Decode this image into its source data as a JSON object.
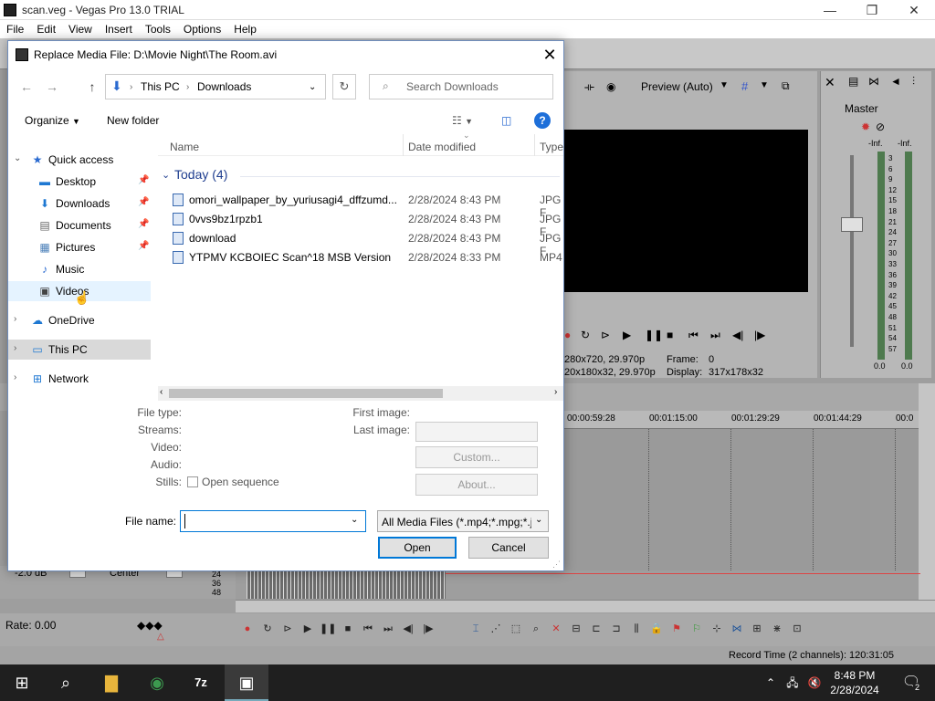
{
  "vegas": {
    "title": "scan.veg - Vegas Pro 13.0 TRIAL",
    "menu": [
      "File",
      "Edit",
      "View",
      "Insert",
      "Tools",
      "Options",
      "Help"
    ],
    "preview_label": "Preview (Auto)",
    "preview_info_1": "280x720, 29.970p",
    "preview_info_2": "20x180x32, 29.970p",
    "frame_label": "Frame:",
    "frame_value": "0",
    "display_label": "Display:",
    "display_value": "317x178x32",
    "master_label": "Master",
    "meter_inf_l": "-Inf.",
    "meter_inf_r": "-Inf.",
    "meter_scale": [
      "3",
      "6",
      "9",
      "12",
      "15",
      "18",
      "21",
      "24",
      "27",
      "30",
      "33",
      "36",
      "39",
      "42",
      "45",
      "48",
      "51",
      "54",
      "57"
    ],
    "meter_bottom_l": "0.0",
    "meter_bottom_r": "0.0",
    "ruler_marks": [
      "00:00:59:28",
      "00:01:15:00",
      "00:01:29:29",
      "00:01:44:29",
      "00:0"
    ],
    "audio_db": "-2.0 dB",
    "audio_pan": "Center",
    "audio_levels": [
      "24",
      "36",
      "48"
    ],
    "rate_label": "Rate: 0.00",
    "record_time": "Record Time (2 channels): 120:31:05"
  },
  "dialog": {
    "title": "Replace Media File: D:\\Movie Night\\The Room.avi",
    "address": [
      "This PC",
      "Downloads"
    ],
    "search_placeholder": "Search Downloads",
    "organize_label": "Organize",
    "new_folder_label": "New folder",
    "nav": [
      {
        "label": "Quick access",
        "icon": "star-icon"
      },
      {
        "label": "Desktop",
        "icon": "desktop-icon",
        "pinned": true
      },
      {
        "label": "Downloads",
        "icon": "download-icon",
        "pinned": true
      },
      {
        "label": "Documents",
        "icon": "document-icon",
        "pinned": true
      },
      {
        "label": "Pictures",
        "icon": "picture-icon",
        "pinned": true
      },
      {
        "label": "Music",
        "icon": "music-icon"
      },
      {
        "label": "Videos",
        "icon": "video-icon"
      },
      {
        "label": "OneDrive",
        "icon": "cloud-icon"
      },
      {
        "label": "This PC",
        "icon": "computer-icon"
      },
      {
        "label": "Network",
        "icon": "network-icon"
      }
    ],
    "columns": {
      "name": "Name",
      "date": "Date modified",
      "type": "Type"
    },
    "group": "Today (4)",
    "files": [
      {
        "name": "omori_wallpaper_by_yuriusagi4_dffzumd...",
        "date": "2/28/2024 8:43 PM",
        "type": "JPG F"
      },
      {
        "name": "0vvs9bz1rpzb1",
        "date": "2/28/2024 8:43 PM",
        "type": "JPG F"
      },
      {
        "name": "download",
        "date": "2/28/2024 8:43 PM",
        "type": "JPG F"
      },
      {
        "name": "YTPMV KCBOIEC Scan^18 MSB Version",
        "date": "2/28/2024 8:33 PM",
        "type": "MP4"
      }
    ],
    "props": {
      "file_type": "File type:",
      "streams": "Streams:",
      "video": "Video:",
      "audio": "Audio:",
      "stills": "Stills:",
      "open_sequence": "Open sequence",
      "first_image": "First image:",
      "last_image": "Last image:",
      "custom": "Custom...",
      "about": "About..."
    },
    "file_name_label": "File name:",
    "file_name_value": "",
    "file_type_filter": "All Media Files (*.mp4;*.mpg;*.j",
    "open_label": "Open",
    "cancel_label": "Cancel"
  },
  "taskbar": {
    "time": "8:48 PM",
    "date": "2/28/2024",
    "notification_count": "2"
  }
}
